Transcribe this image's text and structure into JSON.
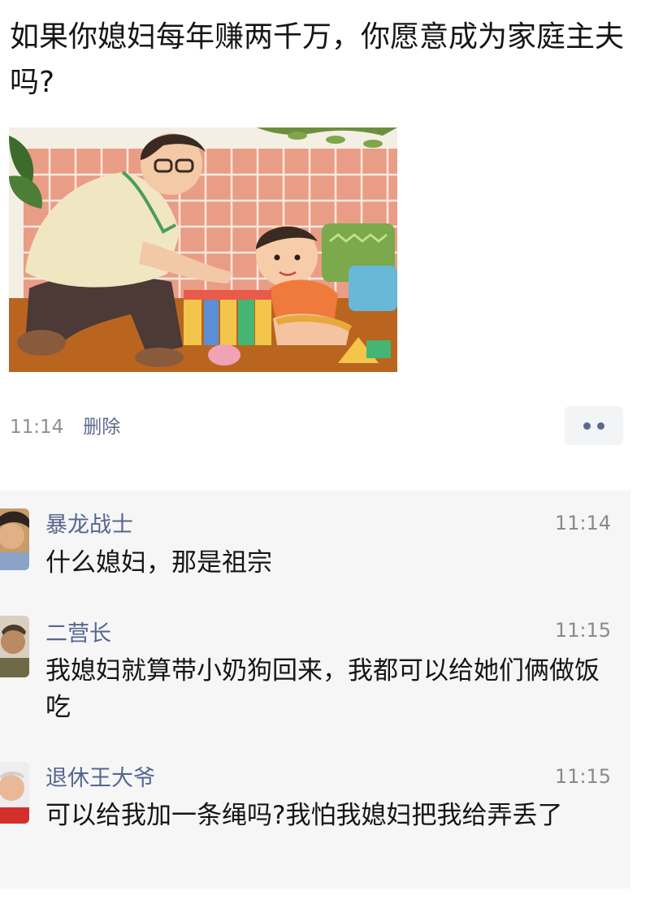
{
  "post": {
    "text": "如果你媳妇每年赚两千万，你愿意成为家庭主夫吗?",
    "time": "11:14",
    "delete_label": "删除"
  },
  "comments": [
    {
      "author": "暴龙战士",
      "time": "11:14",
      "text": "什么媳妇，那是祖宗"
    },
    {
      "author": "二营长",
      "time": "11:15",
      "text": "我媳妇就算带小奶狗回来，我都可以给她们俩做饭吃"
    },
    {
      "author": "退休王大爷",
      "time": "11:15",
      "text": "可以给我加一条绳吗?我怕我媳妇把我给弄丢了"
    }
  ],
  "colors": {
    "link": "#56668f",
    "comment_bg": "#f6f6f7",
    "more_bg": "#f3f4f6"
  },
  "icons": {
    "more": "more-dots-icon"
  }
}
